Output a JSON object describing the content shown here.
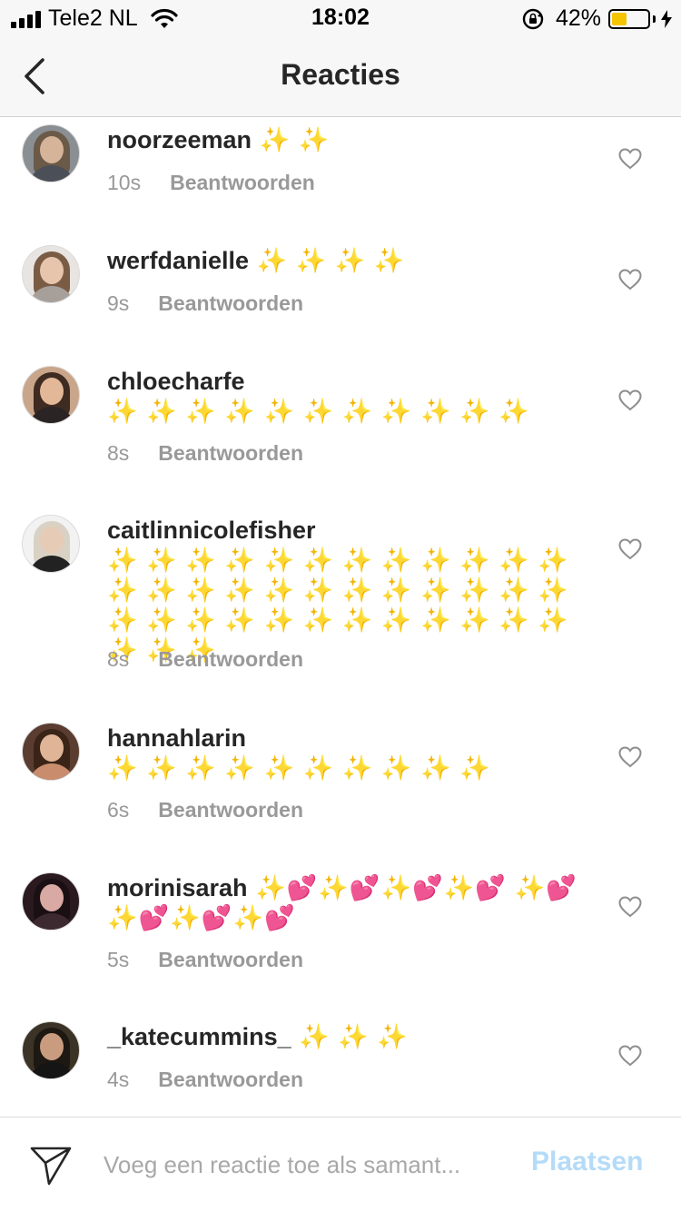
{
  "status_bar": {
    "carrier": "Tele2 NL",
    "time": "18:02",
    "battery_percent": "42%",
    "battery_level": 0.42,
    "battery_color": "#f5c400"
  },
  "nav": {
    "back_icon": "chevron-left-icon",
    "title": "Reacties"
  },
  "comments": [
    {
      "user": "noorzeeman",
      "text": " ✨ ✨",
      "time": "10s",
      "reply": "Beantwoorden"
    },
    {
      "user": "werfdanielle",
      "text": " ✨ ✨ ✨ ✨",
      "time": "9s",
      "reply": "Beantwoorden"
    },
    {
      "user": "chloecharfe",
      "text": "✨ ✨ ✨ ✨ ✨ ✨ ✨ ✨ ✨ ✨ ✨",
      "time": "8s",
      "reply": "Beantwoorden"
    },
    {
      "user": "caitlinnicolefisher",
      "text": "✨ ✨ ✨ ✨ ✨ ✨ ✨ ✨ ✨ ✨ ✨ ✨ ✨ ✨ ✨ ✨ ✨ ✨ ✨ ✨ ✨ ✨ ✨ ✨ ✨ ✨ ✨ ✨ ✨ ✨ ✨ ✨ ✨ ✨ ✨ ✨ ✨ ✨ ✨",
      "time": "8s",
      "reply": "Beantwoorden"
    },
    {
      "user": "hannahlarin",
      "text": "✨ ✨ ✨ ✨ ✨ ✨ ✨ ✨ ✨ ✨",
      "time": "6s",
      "reply": "Beantwoorden"
    },
    {
      "user": "morinisarah",
      "text": " ✨💕✨💕✨💕✨💕 ✨💕✨💕✨💕✨💕",
      "time": "5s",
      "reply": "Beantwoorden"
    },
    {
      "user": "_katecummins_",
      "text": " ✨ ✨ ✨",
      "time": "4s",
      "reply": "Beantwoorden"
    }
  ],
  "footer": {
    "send_icon": "paper-plane-icon",
    "input_placeholder": "Voeg een reactie toe als samant...",
    "post_label": "Plaatsen",
    "post_color": "#b4dbf8"
  }
}
